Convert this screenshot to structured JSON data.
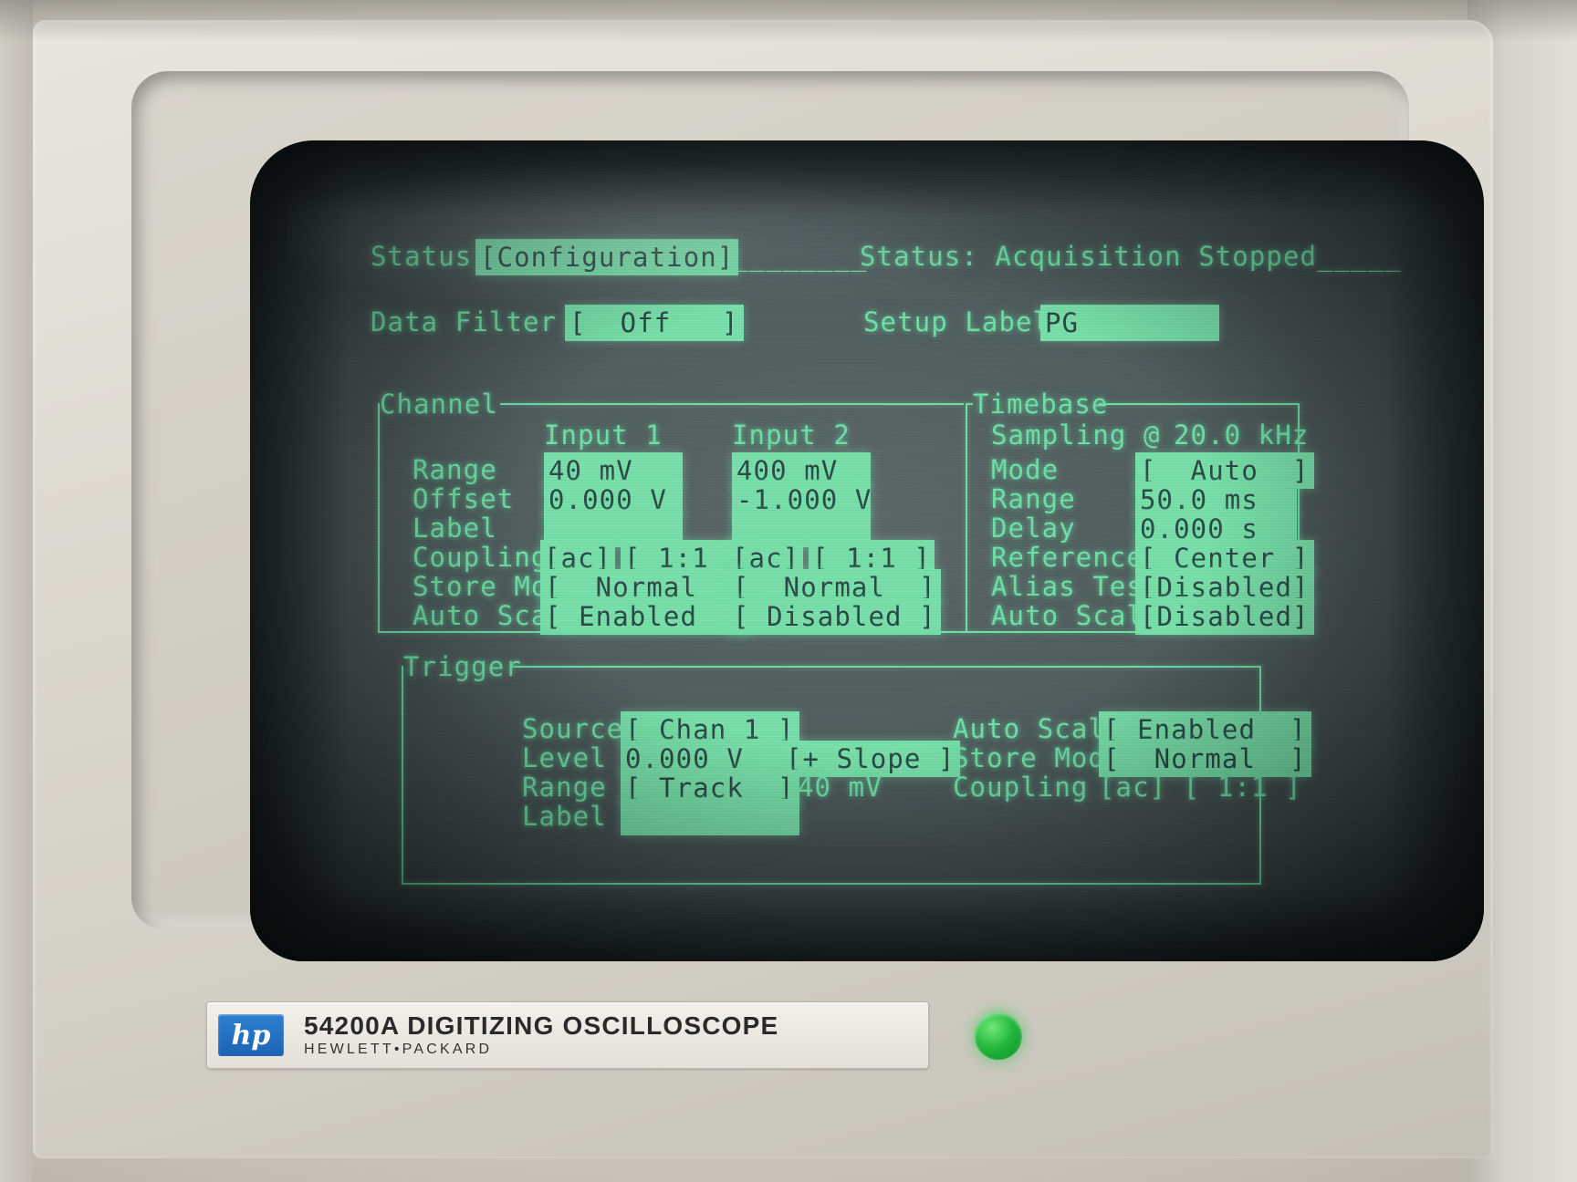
{
  "device": {
    "vendor": "hp",
    "model_line": "54200A  DIGITIZING   OSCILLOSCOPE",
    "brand_line": "HEWLETT•PACKARD",
    "power_led": "power-led"
  },
  "screen": {
    "status_row": {
      "label": "Status",
      "value": "[Configuration]",
      "separator": "________",
      "message": "Status: Acquisition Stopped_____"
    },
    "filter_row": {
      "label": "Data Filter",
      "value": "[  Off   ]",
      "setup_label_caption": "Setup Label",
      "setup_label_value": "PG        "
    },
    "channel": {
      "title": "Channel",
      "columns": [
        "Input 1",
        "Input 2"
      ],
      "rows": [
        {
          "label": "Range",
          "input1": "40 mV    ",
          "input2": "400 mV   "
        },
        {
          "label": "Offset",
          "input1": "0.000 V  ",
          "input2": "-1.000 V "
        },
        {
          "label": "Label",
          "input1": "         ",
          "input2": "         "
        },
        {
          "label": "Coupling",
          "input1": "[ac]",
          "input1b": "[ 1:1 ]",
          "input2": "[ac]",
          "input2b": "[ 1:1 ]"
        },
        {
          "label": "Store Mode",
          "input1": "[  Normal  ]",
          "input2": "[  Normal  ]"
        },
        {
          "label": "Auto Scale",
          "input1": "[ Enabled  ]",
          "input2": "[ Disabled ]"
        }
      ]
    },
    "timebase": {
      "title": "Timebase",
      "sampling_label": "Sampling @",
      "sampling_value": "20.0 kHz",
      "rows": [
        {
          "label": "Mode",
          "value": "[  Auto  ]"
        },
        {
          "label": "Range",
          "value": "50.0 ms  "
        },
        {
          "label": "Delay",
          "value": "0.000 s  "
        },
        {
          "label": "Reference",
          "value": "[ Center ]"
        },
        {
          "label": "Alias Test",
          "value": "[Disabled]"
        },
        {
          "label": "Auto Scale",
          "value": "[Disabled]"
        }
      ]
    },
    "trigger": {
      "title": "Trigger",
      "left_rows": [
        {
          "label": "Source",
          "value": "[ Chan 1 ]"
        },
        {
          "label": "Level",
          "value": "0.000 V   "
        },
        {
          "label": "Range",
          "value": "[ Track  ]"
        },
        {
          "label": "Label",
          "value": "          "
        }
      ],
      "slope_value": "[+ Slope ]",
      "slope_range_text": "40 mV",
      "right_rows": [
        {
          "label": "Auto Scale",
          "value": "[ Enabled  ]"
        },
        {
          "label": "Store Mode",
          "value": "[  Normal  ]"
        },
        {
          "label": "Coupling",
          "value": "[ac] [ 1:1 ]"
        }
      ]
    }
  },
  "colors": {
    "phosphor": "#6fe0a8",
    "highlight": "#79e0ab",
    "screen_bg": "#515c5d",
    "panel": "#ddd9d0",
    "led": "#21b63a",
    "hp_blue": "#1d63b4"
  }
}
